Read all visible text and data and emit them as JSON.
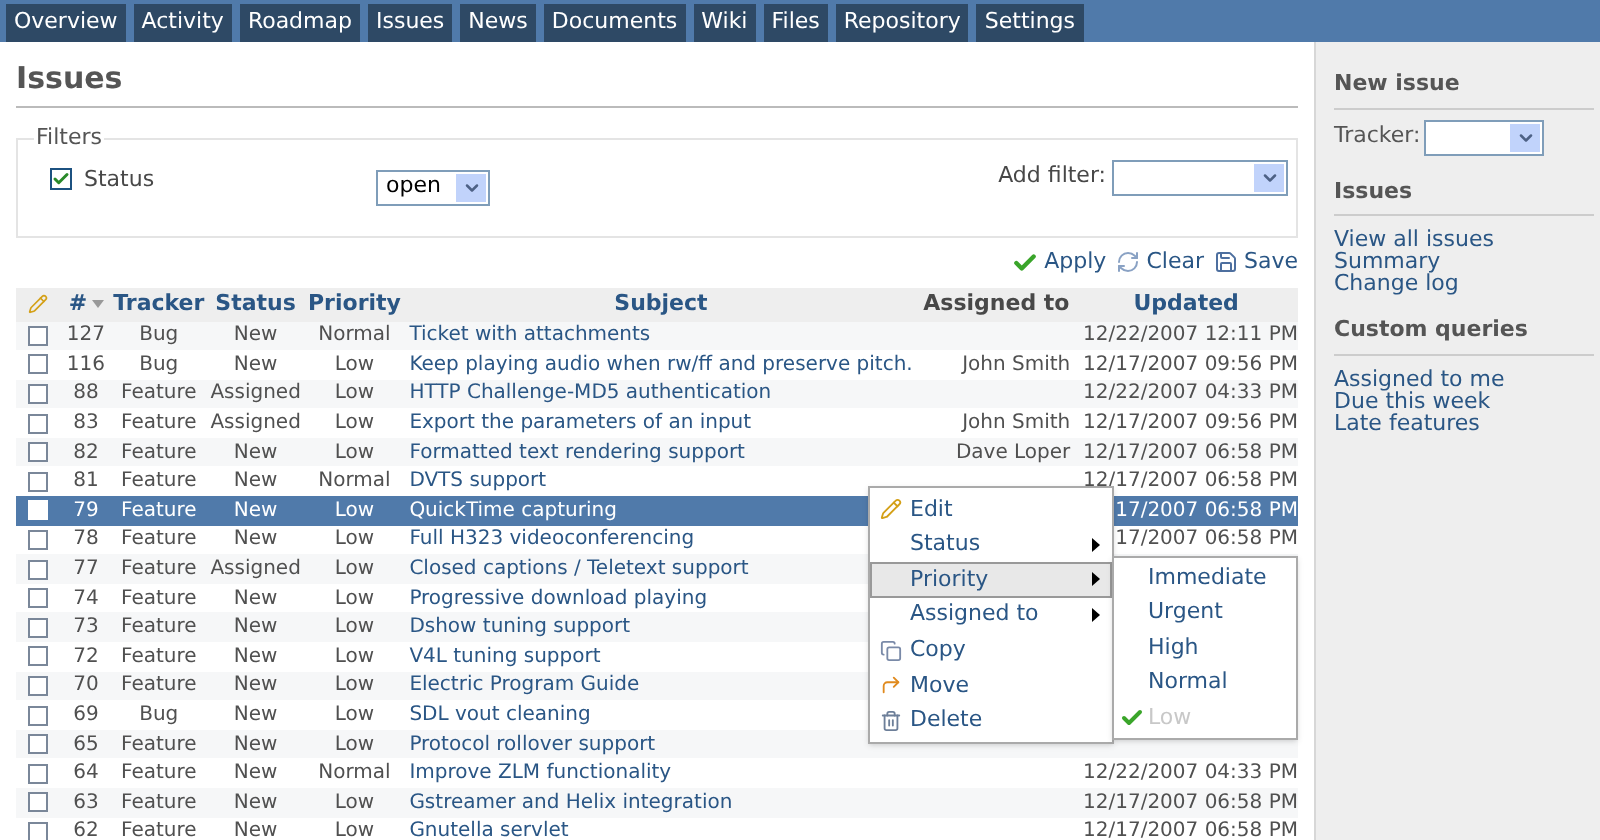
{
  "nav": {
    "tabs": [
      "Overview",
      "Activity",
      "Roadmap",
      "Issues",
      "News",
      "Documents",
      "Wiki",
      "Files",
      "Repository",
      "Settings"
    ]
  },
  "page_title": "Issues",
  "filters": {
    "legend": "Filters",
    "status": {
      "label": "Status",
      "checked": true,
      "value": "open"
    },
    "add_filter": {
      "label": "Add filter:"
    }
  },
  "actions": [
    {
      "kind": "apply",
      "label": "Apply"
    },
    {
      "kind": "clear",
      "label": "Clear"
    },
    {
      "kind": "save",
      "label": "Save"
    }
  ],
  "table": {
    "columns": [
      "#",
      "Tracker",
      "Status",
      "Priority",
      "Subject",
      "Assigned to",
      "Updated"
    ],
    "rows": [
      {
        "id": "127",
        "tracker": "Bug",
        "status": "New",
        "priority": "Normal",
        "subject": "Ticket with attachments",
        "assigned_to": "",
        "updated": "12/22/2007 12:11 PM",
        "selected": false
      },
      {
        "id": "116",
        "tracker": "Bug",
        "status": "New",
        "priority": "Low",
        "subject": "Keep playing audio when rw/ff and preserve pitch.",
        "assigned_to": "John Smith",
        "updated": "12/17/2007 09:56 PM",
        "selected": false
      },
      {
        "id": "88",
        "tracker": "Feature",
        "status": "Assigned",
        "priority": "Low",
        "subject": "HTTP Challenge-MD5 authentication",
        "assigned_to": "",
        "updated": "12/22/2007 04:33 PM",
        "selected": false
      },
      {
        "id": "83",
        "tracker": "Feature",
        "status": "Assigned",
        "priority": "Low",
        "subject": "Export the parameters of an input",
        "assigned_to": "John Smith",
        "updated": "12/17/2007 09:56 PM",
        "selected": false
      },
      {
        "id": "82",
        "tracker": "Feature",
        "status": "New",
        "priority": "Low",
        "subject": "Formatted text rendering support",
        "assigned_to": "Dave Loper",
        "updated": "12/17/2007 06:58 PM",
        "selected": false
      },
      {
        "id": "81",
        "tracker": "Feature",
        "status": "New",
        "priority": "Normal",
        "subject": "DVTS support",
        "assigned_to": "",
        "updated": "12/17/2007 06:58 PM",
        "selected": false
      },
      {
        "id": "79",
        "tracker": "Feature",
        "status": "New",
        "priority": "Low",
        "subject": "QuickTime capturing",
        "assigned_to": "",
        "updated": "17/2007 06:58 PM",
        "selected": true
      },
      {
        "id": "78",
        "tracker": "Feature",
        "status": "New",
        "priority": "Low",
        "subject": "Full H323 videoconferencing",
        "assigned_to": "",
        "updated": "17/2007 06:58 PM",
        "selected": false
      },
      {
        "id": "77",
        "tracker": "Feature",
        "status": "Assigned",
        "priority": "Low",
        "subject": "Closed captions / Teletext support",
        "assigned_to": "",
        "updated": "",
        "selected": false
      },
      {
        "id": "74",
        "tracker": "Feature",
        "status": "New",
        "priority": "Low",
        "subject": "Progressive download playing",
        "assigned_to": "",
        "updated": "",
        "selected": false
      },
      {
        "id": "73",
        "tracker": "Feature",
        "status": "New",
        "priority": "Low",
        "subject": "Dshow tuning support",
        "assigned_to": "",
        "updated": "",
        "selected": false
      },
      {
        "id": "72",
        "tracker": "Feature",
        "status": "New",
        "priority": "Low",
        "subject": "V4L tuning support",
        "assigned_to": "",
        "updated": "",
        "selected": false
      },
      {
        "id": "70",
        "tracker": "Feature",
        "status": "New",
        "priority": "Low",
        "subject": "Electric Program Guide",
        "assigned_to": "",
        "updated": "",
        "selected": false
      },
      {
        "id": "69",
        "tracker": "Bug",
        "status": "New",
        "priority": "Low",
        "subject": "SDL vout cleaning",
        "assigned_to": "",
        "updated": "",
        "selected": false
      },
      {
        "id": "65",
        "tracker": "Feature",
        "status": "New",
        "priority": "Low",
        "subject": "Protocol rollover support",
        "assigned_to": "",
        "updated": "",
        "selected": false
      },
      {
        "id": "64",
        "tracker": "Feature",
        "status": "New",
        "priority": "Normal",
        "subject": "Improve ZLM functionality",
        "assigned_to": "",
        "updated": "12/22/2007 04:33 PM",
        "selected": false
      },
      {
        "id": "63",
        "tracker": "Feature",
        "status": "New",
        "priority": "Low",
        "subject": "Gstreamer and Helix integration",
        "assigned_to": "",
        "updated": "12/17/2007 06:58 PM",
        "selected": false
      },
      {
        "id": "62",
        "tracker": "Feature",
        "status": "New",
        "priority": "Low",
        "subject": "Gnutella servlet",
        "assigned_to": "",
        "updated": "12/17/2007 06:58 PM",
        "selected": false
      }
    ]
  },
  "context_menu": {
    "items": [
      {
        "kind": "edit",
        "label": "Edit",
        "selected": false
      },
      {
        "kind": "submenu",
        "label": "Status",
        "selected": false
      },
      {
        "kind": "submenu",
        "label": "Priority",
        "selected": true
      },
      {
        "kind": "submenu",
        "label": "Assigned to",
        "selected": false
      },
      {
        "kind": "copy",
        "label": "Copy",
        "selected": false
      },
      {
        "kind": "move",
        "label": "Move",
        "selected": false
      },
      {
        "kind": "delete",
        "label": "Delete",
        "selected": false
      }
    ],
    "submenu": [
      {
        "label": "Immediate",
        "disabled": false,
        "checked": false
      },
      {
        "label": "Urgent",
        "disabled": false,
        "checked": false
      },
      {
        "label": "High",
        "disabled": false,
        "checked": false
      },
      {
        "label": "Normal",
        "disabled": false,
        "checked": false
      },
      {
        "label": "Low",
        "disabled": true,
        "checked": true
      }
    ]
  },
  "sidebar": {
    "new_issue": {
      "title": "New issue",
      "tracker_label": "Tracker:"
    },
    "sections": [
      {
        "title": "Issues",
        "links": [
          "View all issues",
          "Summary",
          "Change log"
        ]
      },
      {
        "title": "Custom queries",
        "links": [
          "Assigned to me",
          "Due this week",
          "Late features"
        ]
      }
    ]
  }
}
